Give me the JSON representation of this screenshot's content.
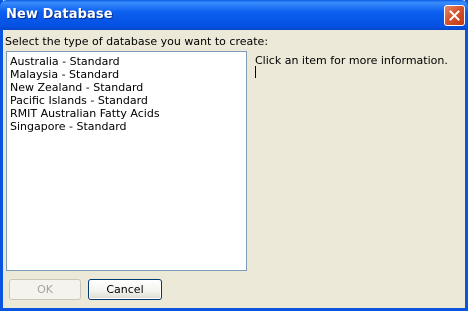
{
  "window": {
    "title": "New Database",
    "close_icon": "close-icon"
  },
  "main": {
    "prompt": "Select the type of database you want to create:",
    "items": [
      {
        "label": "Australia - Standard"
      },
      {
        "label": "Malaysia - Standard"
      },
      {
        "label": "New Zealand - Standard"
      },
      {
        "label": "Pacific Islands - Standard"
      },
      {
        "label": "RMIT Australian Fatty Acids"
      },
      {
        "label": "Singapore - Standard"
      }
    ],
    "info": "Click an item for more information."
  },
  "buttons": {
    "ok_label": "OK",
    "ok_enabled": false,
    "cancel_label": "Cancel"
  },
  "colors": {
    "titlebar": "#0a5ae6",
    "dialog_bg": "#ece9d8",
    "close_button": "#d5542e"
  }
}
